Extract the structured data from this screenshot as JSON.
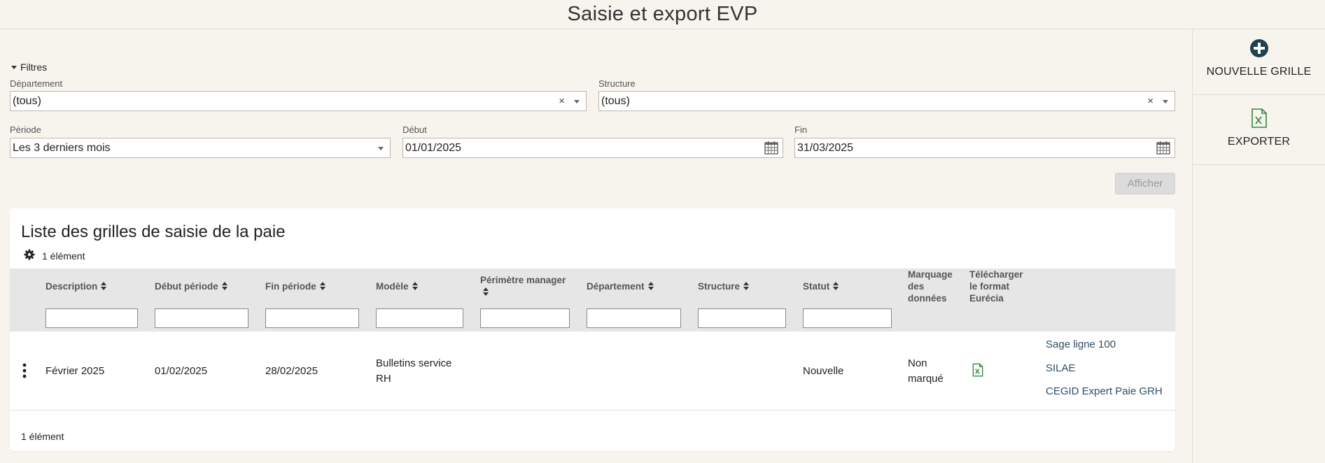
{
  "page": {
    "title": "Saisie et export EVP"
  },
  "sidebar": {
    "new_grid_label": "NOUVELLE GRILLE",
    "export_label": "EXPORTER"
  },
  "filters": {
    "toggle_label": "Filtres",
    "departement": {
      "label": "Département",
      "value": "(tous)"
    },
    "structure": {
      "label": "Structure",
      "value": "(tous)"
    },
    "periode": {
      "label": "Période",
      "value": "Les 3 derniers mois"
    },
    "debut": {
      "label": "Début",
      "value": "01/01/2025"
    },
    "fin": {
      "label": "Fin",
      "value": "31/03/2025"
    },
    "afficher_label": "Afficher"
  },
  "list": {
    "title": "Liste des grilles de saisie de la paie",
    "count_top": "1 élément",
    "count_bottom": "1 élément",
    "columns": {
      "description": "Description",
      "debut_periode": "Début période",
      "fin_periode": "Fin période",
      "modele": "Modèle",
      "perimetre": "Périmètre manager",
      "departement": "Département",
      "structure": "Structure",
      "statut": "Statut",
      "marquage_line1": "Marquage",
      "marquage_line2": "des",
      "marquage_line3": "données",
      "telecharger_line1": "Télécharger",
      "telecharger_line2": "le format",
      "telecharger_line3": "Eurécia"
    },
    "rows": [
      {
        "description": "Février 2025",
        "debut": "01/02/2025",
        "fin": "28/02/2025",
        "modele_line1": "Bulletins service",
        "modele_line2": "RH",
        "perimetre": "",
        "departement": "",
        "structure": "",
        "statut": "Nouvelle",
        "marquage_line1": "Non",
        "marquage_line2": "marqué",
        "exports": [
          "Sage ligne 100",
          "SILAE",
          "CEGID Expert Paie GRH"
        ]
      }
    ]
  },
  "colors": {
    "accent_dark": "#1f4150",
    "excel_green": "#2e8b3e",
    "link": "#2d4f68"
  }
}
